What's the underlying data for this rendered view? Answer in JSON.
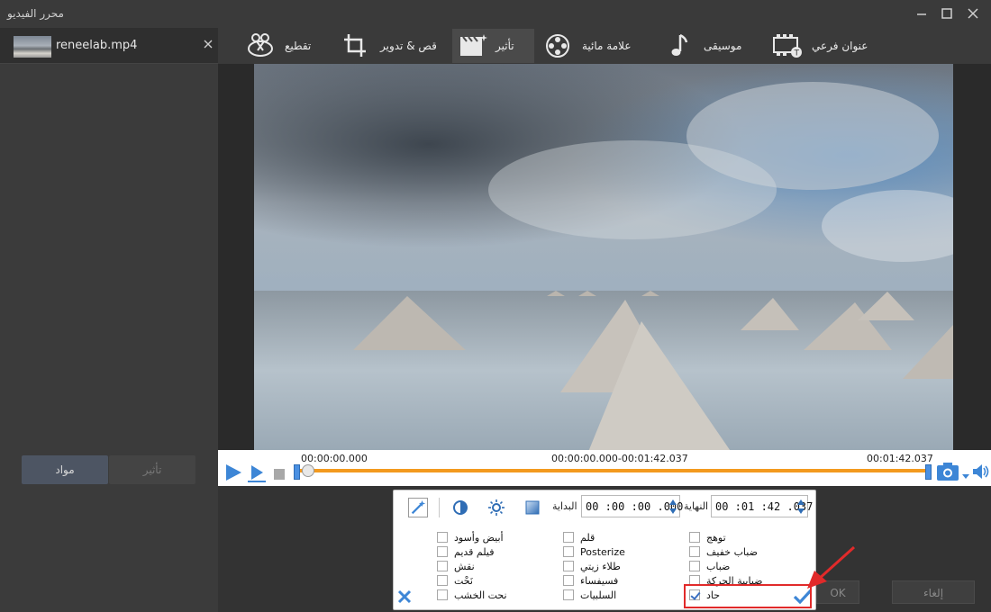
{
  "window": {
    "title": "محرر الفيديو"
  },
  "file": {
    "name": "reneelab.mp4"
  },
  "left_buttons": {
    "effect": "تأثير",
    "material": "مواد"
  },
  "tabs": [
    {
      "label": "عنوان فرعي",
      "icon": "subtitle-icon"
    },
    {
      "label": "موسيقى",
      "icon": "music-note-icon"
    },
    {
      "label": "علامة مائية",
      "icon": "film-reel-icon"
    },
    {
      "label": "تأثير",
      "icon": "effect-clapper-icon",
      "active": true
    },
    {
      "label": "قص & تدوير",
      "icon": "crop-icon"
    },
    {
      "label": "تقطيع",
      "icon": "scissors-icon"
    }
  ],
  "timeline": {
    "start_time": "00:00:00.000",
    "range": "00:00:00.000-00:01:42.037",
    "end_time": "00:01:42.037"
  },
  "panel": {
    "end_label": "النهاية",
    "end_value": "00 :01 :42 .037",
    "start_label": "البداية",
    "start_value": "00 :00 :00 .000"
  },
  "effects": {
    "col1": [
      {
        "label": "أبيض وأسود",
        "checked": false
      },
      {
        "label": "فيلم قديم",
        "checked": false
      },
      {
        "label": "نقش",
        "checked": false
      },
      {
        "label": "نَحْت",
        "checked": false
      },
      {
        "label": "نحت الخشب",
        "checked": false
      }
    ],
    "col2": [
      {
        "label": "قلم",
        "checked": false
      },
      {
        "label": "Posterize",
        "checked": false
      },
      {
        "label": "طلاء زيتي",
        "checked": false
      },
      {
        "label": "فسيفساء",
        "checked": false
      },
      {
        "label": "السلبيات",
        "checked": false
      }
    ],
    "col3": [
      {
        "label": "توهج",
        "checked": false
      },
      {
        "label": "ضباب خفيف",
        "checked": false
      },
      {
        "label": "ضباب",
        "checked": false
      },
      {
        "label": "ضبابية الحركة",
        "checked": false
      },
      {
        "label": "حاد",
        "checked": true
      }
    ]
  },
  "footer": {
    "ok": "OK",
    "cancel": "إلغاء"
  },
  "colors": {
    "accent": "#4a90e2",
    "track": "#f39a1e",
    "highlight": "#e12a2a"
  }
}
